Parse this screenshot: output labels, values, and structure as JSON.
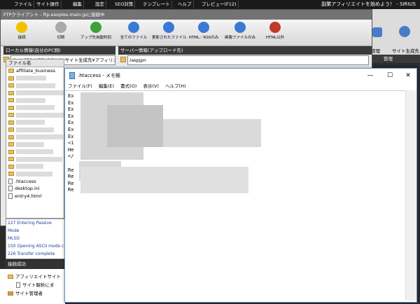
{
  "menubar": {
    "items": [
      "ファイル",
      "サイト操作",
      "編集",
      "設定",
      "SEO対策",
      "テンプレート",
      "ヘルプ",
      "プレビュー(F12)"
    ],
    "app_title": "副業アフィリエイトを始めよう！ - SIRIUS"
  },
  "right_toolbar": {
    "manage_label": "管理",
    "site_gen_label": "サイト生成先",
    "section_label": "管理"
  },
  "ftp": {
    "title": "FTPクライアント - ftp.esoples.main.jpに接続中",
    "toolbar": [
      {
        "label": "接続",
        "icon": "connect-icon",
        "color": "#f2c200"
      },
      {
        "label": "切断",
        "icon": "disconnect-icon",
        "color": "#aaaaaa"
      },
      {
        "label": "アップ先自動判別",
        "icon": "check-icon",
        "color": "#3aa33a"
      },
      {
        "label": "全てのファイル",
        "icon": "all-files-icon",
        "color": "#3a7ad6"
      },
      {
        "label": "更新されたファイル",
        "icon": "updated-files-icon",
        "color": "#3a7ad6"
      },
      {
        "label": "HTML／RSSのみ",
        "icon": "html-rss-icon",
        "color": "#3a7ad6"
      },
      {
        "label": "画像ファイルのみ",
        "icon": "image-files-icon",
        "color": "#3a7ad6"
      },
      {
        "label": "HTML以外",
        "icon": "non-html-icon",
        "color": "#c0392b"
      }
    ],
    "local_header": "ローカル情報(自分のPC側)",
    "server_header": "サーバー情報(アップロード先)",
    "local_path": "C:¥ACES WEB¥SIRIUS¥サイト生成先¥アフィリエ",
    "server_path": "/aspjpn",
    "file_header": "ファイル名",
    "files": [
      {
        "name": "affiliate_business",
        "type": "folder"
      },
      {
        "name": "",
        "type": "folder"
      },
      {
        "name": "",
        "type": "folder"
      },
      {
        "name": "",
        "type": "folder"
      },
      {
        "name": "",
        "type": "folder"
      },
      {
        "name": "",
        "type": "folder"
      },
      {
        "name": "",
        "type": "folder"
      },
      {
        "name": "",
        "type": "folder"
      },
      {
        "name": "",
        "type": "folder"
      },
      {
        "name": "",
        "type": "folder"
      },
      {
        "name": "",
        "type": "folder"
      },
      {
        "name": "",
        "type": "folder"
      },
      {
        "name": "",
        "type": "folder"
      },
      {
        "name": "",
        "type": "folder"
      },
      {
        "name": "",
        "type": "folder"
      },
      {
        "name": ".htaccess",
        "type": "file"
      },
      {
        "name": "desktop.ini",
        "type": "file"
      },
      {
        "name": "entry4.html",
        "type": "file"
      }
    ],
    "log": [
      "227 Entering Passive Mode",
      "MLSD",
      "150 Opening ASCII mode c",
      "226 Transfer complete"
    ],
    "status": "接続成功"
  },
  "tree": {
    "items": [
      "アフィリエイトサイト",
      "サイト解析にま",
      "サイト管理者"
    ]
  },
  "notepad": {
    "title": ".htaccess - メモ帳",
    "menu": [
      "ファイル(F)",
      "編集(E)",
      "書式(O)",
      "表示(V)",
      "ヘルプ(H)"
    ],
    "lines": [
      "Ex",
      "Ex",
      "Ex",
      "Ex",
      "Ex",
      "Ex",
      "Ex",
      "<i",
      "He",
      "</",
      "",
      "Re",
      "Re",
      "Re",
      "Re"
    ],
    "minimize": "—",
    "maximize": "☐",
    "close": "✕"
  }
}
